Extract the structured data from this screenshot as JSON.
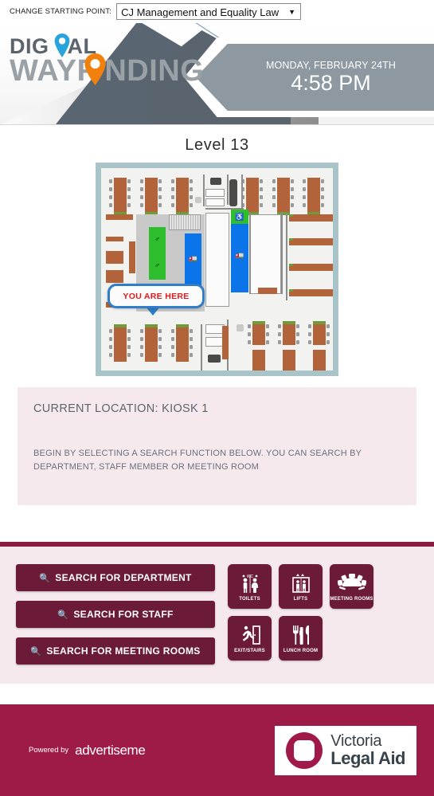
{
  "topbar": {
    "label": "CHANGE STARTING POINT:",
    "selected_option": "CJ Management and Equality Law",
    "arrow_icon": "chevron-down-icon"
  },
  "header": {
    "logo_line1": "DIG TAL",
    "logo_line2": "WAYF NDING",
    "date": "MONDAY, FEBRUARY 24TH",
    "time": "4:58 PM"
  },
  "map": {
    "level_title": "Level  13",
    "you_are_here": "YOU ARE HERE"
  },
  "info": {
    "current_location": "CURRENT LOCATION: KIOSK 1",
    "hint": "BEGIN BY SELECTING A SEARCH FUNCTION BELOW. YOU CAN SEARCH BY DEPARTMENT, STAFF MEMBER OR MEETING ROOM"
  },
  "actions": {
    "search_icon": "search-icon",
    "buttons": [
      {
        "label": "SEARCH FOR DEPARTMENT"
      },
      {
        "label": "SEARCH FOR STAFF"
      },
      {
        "label": "SEARCH FOR MEETING ROOMS"
      }
    ],
    "tiles": [
      {
        "label": "TOILETS",
        "icon": "toilets-icon"
      },
      {
        "label": "LIFTS",
        "icon": "lift-icon"
      },
      {
        "label": "MEETING ROOMS",
        "icon": "meeting-room-icon"
      },
      {
        "label": "EXIT/STAIRS",
        "icon": "exit-stairs-icon"
      },
      {
        "label": "LUNCH ROOM",
        "icon": "lunch-room-icon"
      }
    ]
  },
  "footer": {
    "powered_by": "Powered by",
    "provider": "advertiseme",
    "client_line1": "Victoria",
    "client_line2": "Legal Aid"
  },
  "colors": {
    "brand_maroon": "#6b1a38",
    "footer_maroon": "#9e1b47",
    "pink_bg": "#f6e9ee",
    "map_border": "#a8c4c8",
    "callout_blue": "#2f7ec7",
    "callout_red": "#e8191c"
  }
}
